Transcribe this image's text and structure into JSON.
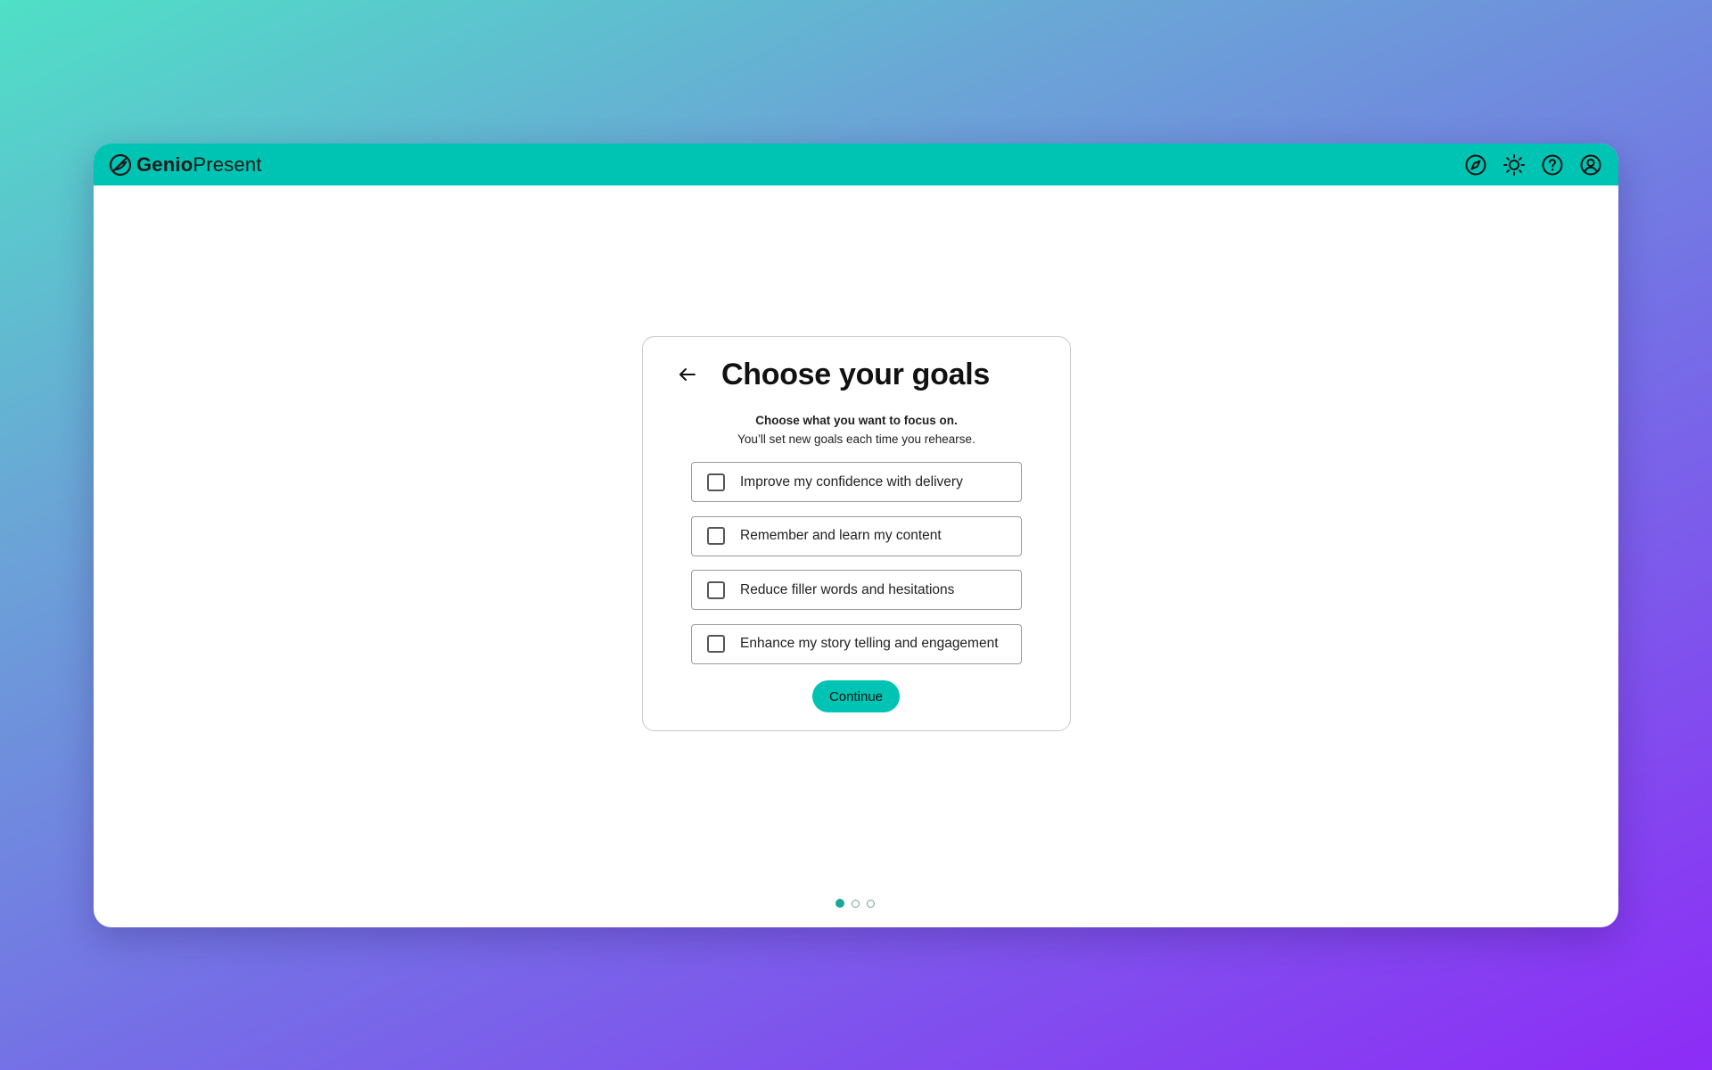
{
  "app": {
    "brand_bold": "Genio",
    "brand_light": "Present"
  },
  "header_icons": [
    "compass-icon",
    "sun-icon",
    "help-icon",
    "account-icon"
  ],
  "onboarding": {
    "title": "Choose your goals",
    "subtitle_line1": "Choose what you want to focus on.",
    "subtitle_line2": "You’ll set new goals each time you rehearse.",
    "options": [
      {
        "label": "Improve my confidence with delivery",
        "checked": false
      },
      {
        "label": "Remember and learn my content",
        "checked": false
      },
      {
        "label": "Reduce filler words and hesitations",
        "checked": false
      },
      {
        "label": "Enhance my story telling and engagement",
        "checked": false
      }
    ],
    "continue_label": "Continue"
  },
  "pagination": {
    "total": 3,
    "current": 1
  },
  "colors": {
    "accent": "#00c4b3",
    "gradient_start": "#4fe0c6",
    "gradient_end": "#8d2cf6"
  }
}
